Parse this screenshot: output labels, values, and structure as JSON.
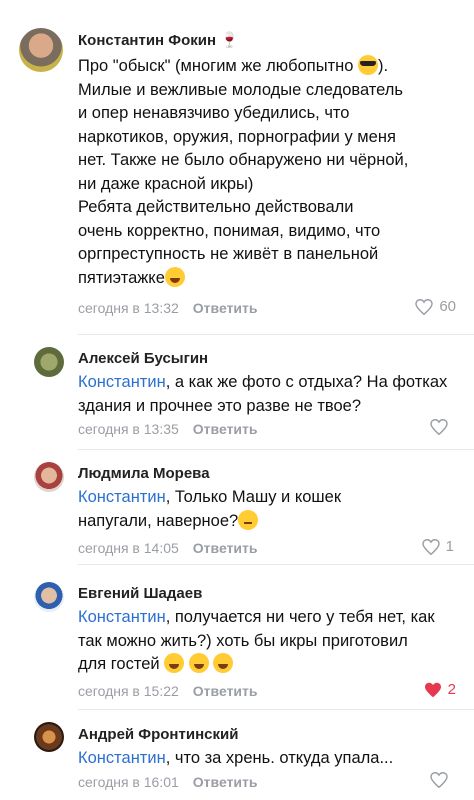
{
  "comments": [
    {
      "name": "Константин Фокин",
      "badge_icon": "wine-glass-icon",
      "lines": [
        "Про \"обыск\" (многим же любопытно ",
        "). ",
        "Милые и вежливые молодые следователь",
        "и опер ненавязчиво убедились, что",
        "наркотиков, оружия, порнографии у меня",
        "нет. Также не было обнаружено ни чёрной,",
        "ни даже красной икры)",
        "Ребята действительно действовали",
        "очень корректно, понимая, видимо, что",
        "оргпреступность не живёт в панельной",
        "пятиэтажке"
      ],
      "time": "сегодня в 13:32",
      "reply": "Ответить",
      "likes": "60"
    },
    {
      "name": "Алексей Бусыгин",
      "mention": "Константин",
      "text": ", а как же фото с отдыха? На фотках здания и прочнее это разве не твое?",
      "time": "сегодня в 13:35",
      "reply": "Ответить",
      "likes": ""
    },
    {
      "name": "Людмила Морева",
      "mention": "Константин",
      "text": ", Только Машу и кошек напугали, наверное?",
      "time": "сегодня в 14:05",
      "reply": "Ответить",
      "likes": "1"
    },
    {
      "name": "Евгений Шадаев",
      "mention": "Константин",
      "text": ", получается ни чего у тебя нет, как так можно жить?) хоть бы икры приготовил для гостей",
      "time": "сегодня в 15:22",
      "reply": "Ответить",
      "likes": "2"
    },
    {
      "name": "Андрей Фронтинский",
      "mention": "Константин",
      "text": ", что за хрень. откуда упала...",
      "time": "сегодня в 16:01",
      "reply": "Ответить",
      "likes": ""
    }
  ],
  "colors": {
    "mention": "#2a6fd1",
    "liked": "#e53950",
    "meta": "#9a9ea4"
  }
}
